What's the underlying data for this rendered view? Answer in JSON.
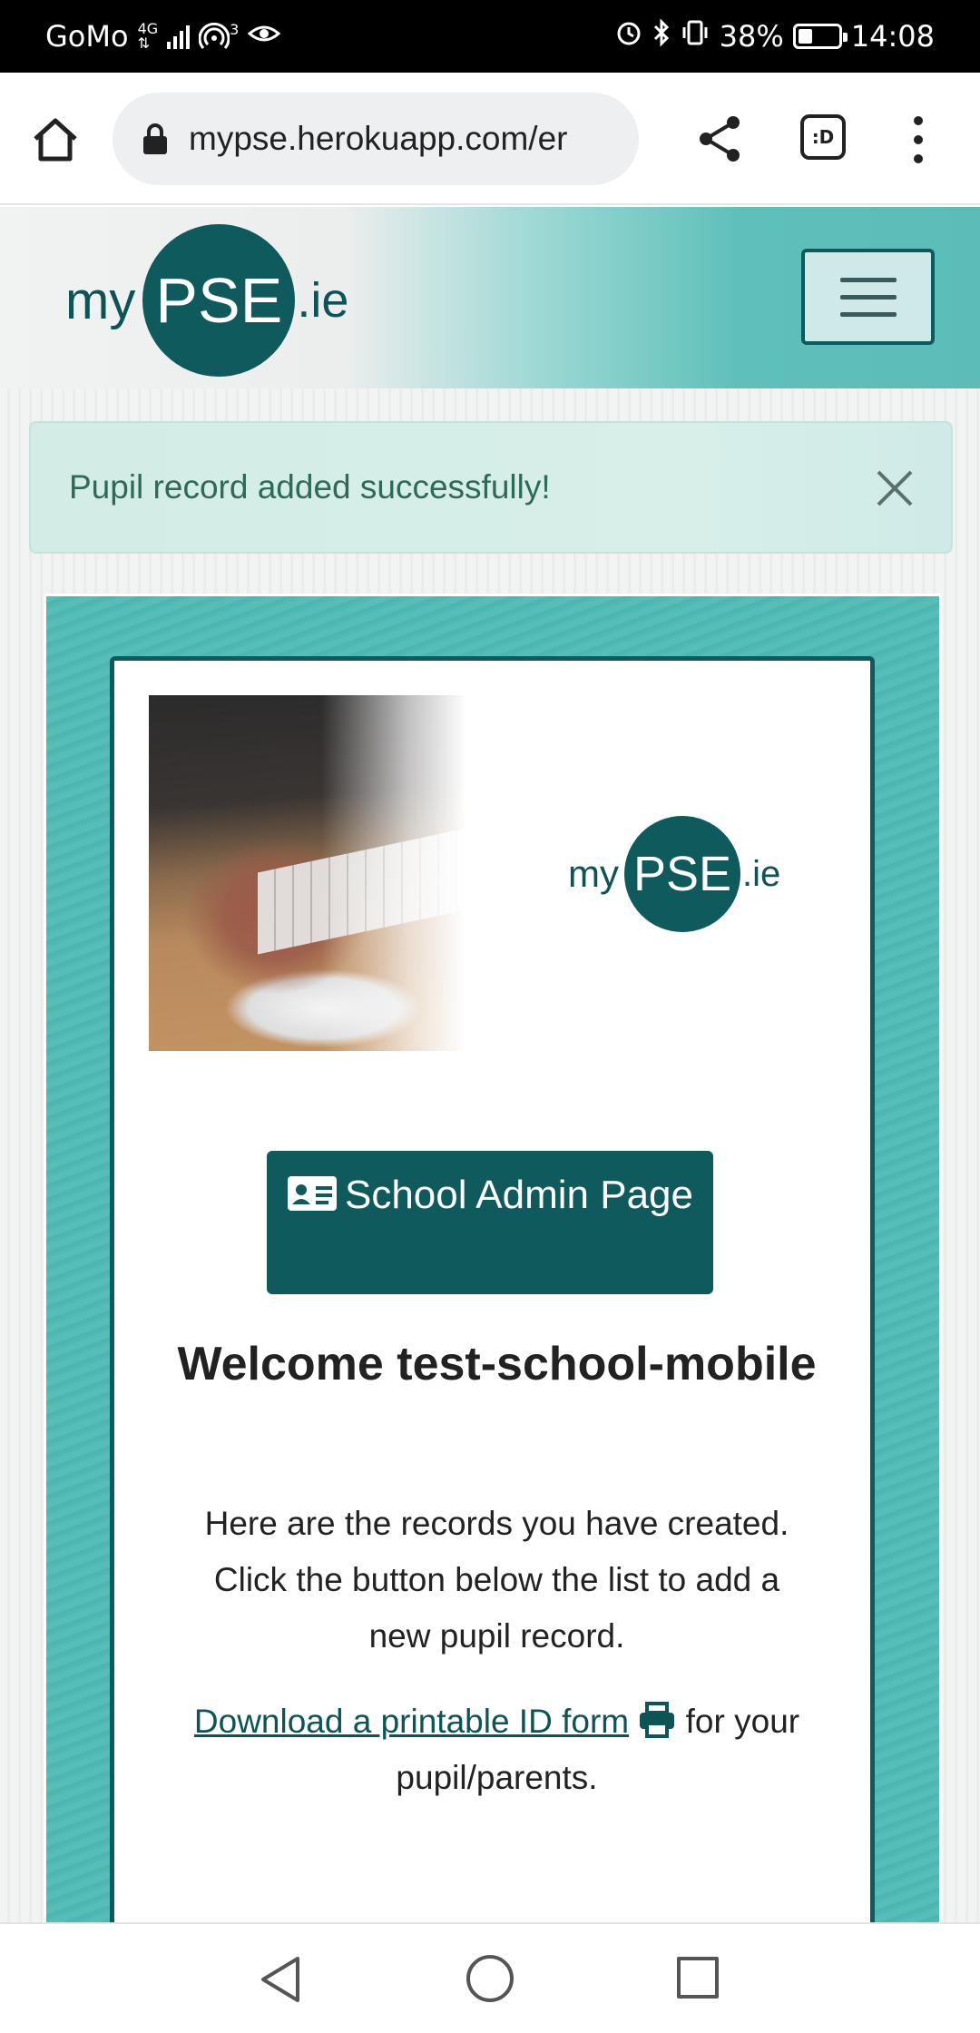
{
  "status_bar": {
    "carrier": "GoMo",
    "network_top": "4G",
    "network_bottom": "⇅",
    "hotspot_count": "3",
    "battery_text": "38%",
    "battery_level": 0.38,
    "time": "14:08"
  },
  "browser": {
    "url": "mypse.herokuapp.com/er",
    "tabs_label": ":D"
  },
  "site": {
    "logo": {
      "my": "my",
      "pse": "PSE",
      "ie": ".ie"
    }
  },
  "alert": {
    "message": "Pupil record added successfully!"
  },
  "card": {
    "logo": {
      "my": "my",
      "pse": "PSE",
      "ie": ".ie"
    },
    "admin_button_label": "School Admin Page",
    "welcome_title": "Welcome test-school-mobile",
    "description": "Here are the records you have created. Click the button below the list to add a new pupil record.",
    "download_link_text": "Download a printable ID form",
    "download_suffix": " for your pupil/parents."
  },
  "colors": {
    "brand_dark_teal": "#0e5a5c",
    "teal_background": "#4dbab3",
    "alert_background": "#d3ece6",
    "alert_text": "#2e6a58"
  },
  "icons": {
    "home": "home-icon",
    "lock": "lock-icon",
    "share": "share-icon",
    "tabs": "tab-switcher-icon",
    "menu": "overflow-menu-icon",
    "close": "close-icon",
    "hamburger": "hamburger-icon",
    "id_card": "id-card-icon",
    "print": "print-icon"
  }
}
